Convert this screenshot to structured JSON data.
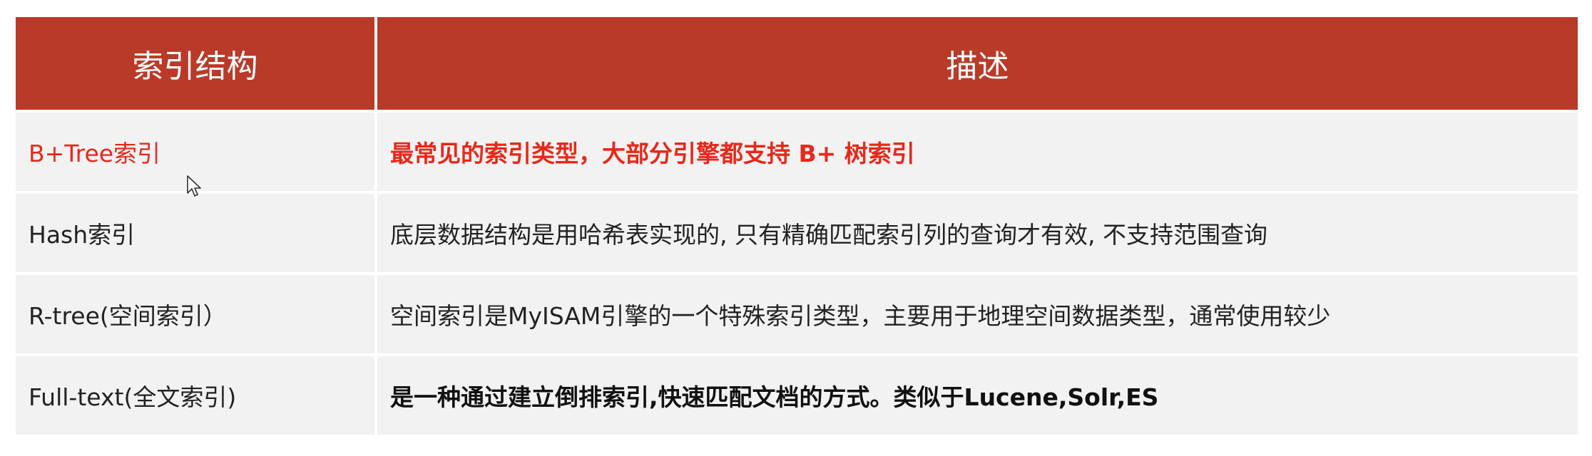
{
  "table": {
    "headers": [
      "索引结构",
      "描述"
    ],
    "rows": [
      {
        "structure": "B+Tree索引",
        "description": "最常见的索引类型，大部分引擎都支持 B+ 树索引"
      },
      {
        "structure": "Hash索引",
        "description": "底层数据结构是用哈希表实现的, 只有精确匹配索引列的查询才有效, 不支持范围查询"
      },
      {
        "structure": "R-tree(空间索引）",
        "description": "空间索引是MyISAM引擎的一个特殊索引类型，主要用于地理空间数据类型，通常使用较少"
      },
      {
        "structure": "Full-text(全文索引)",
        "description": "是一种通过建立倒排索引,快速匹配文档的方式。类似于Lucene,Solr,ES"
      }
    ]
  },
  "colors": {
    "header_bg": "#b93a28",
    "header_text": "#ffffff",
    "row_bg": "#f2f2f2",
    "highlight_text": "#e8281a"
  },
  "icons": {
    "cursor": "mouse-pointer-icon"
  }
}
